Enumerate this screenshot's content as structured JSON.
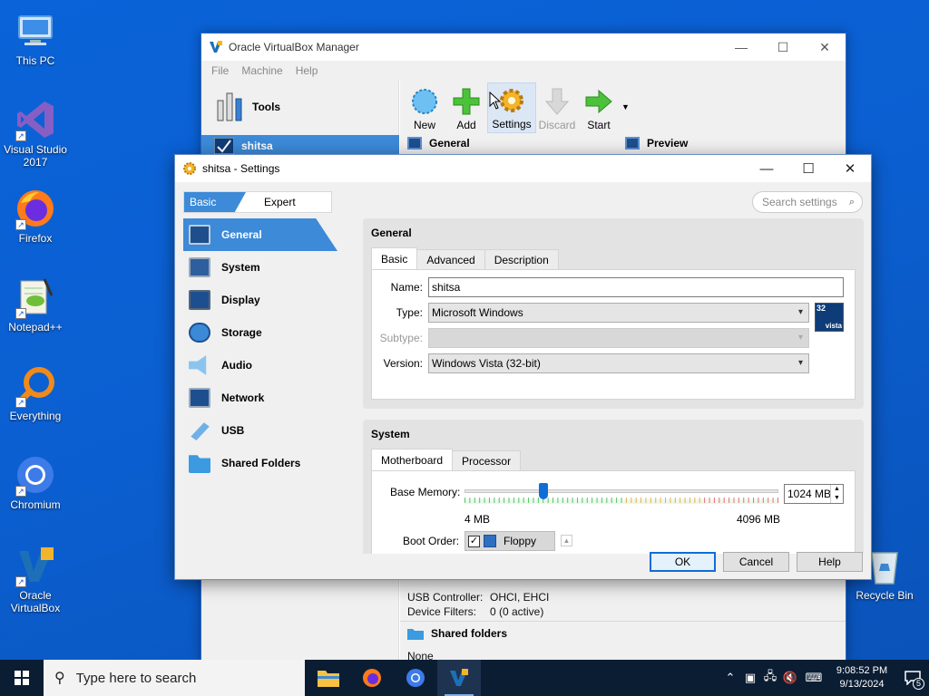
{
  "desktop": {
    "icons": [
      {
        "label": "This PC",
        "icon": "computer-icon"
      },
      {
        "label": "Visual Studio 2017",
        "icon": "visual-studio-icon"
      },
      {
        "label": "Firefox",
        "icon": "firefox-icon"
      },
      {
        "label": "Notepad++",
        "icon": "notepadpp-icon"
      },
      {
        "label": "Everything",
        "icon": "everything-icon"
      },
      {
        "label": "Chromium",
        "icon": "chromium-icon"
      },
      {
        "label": "Oracle VirtualBox",
        "icon": "virtualbox-icon"
      },
      {
        "label": "Recycle Bin",
        "icon": "recycle-bin-icon"
      }
    ]
  },
  "manager": {
    "title": "Oracle VirtualBox Manager",
    "menu": [
      "File",
      "Machine",
      "Help"
    ],
    "tools_label": "Tools",
    "vm_name": "shitsa",
    "toolbar": {
      "new": "New",
      "add": "Add",
      "settings": "Settings",
      "discard": "Discard",
      "start": "Start"
    },
    "general_header": "General",
    "preview_header": "Preview",
    "usb": {
      "controller_label": "USB Controller:",
      "controller_value": "OHCI, EHCI",
      "filters_label": "Device Filters:",
      "filters_value": "0 (0 active)"
    },
    "shared_header": "Shared folders",
    "shared_value": "None"
  },
  "dialog": {
    "title": "shitsa - Settings",
    "mode_basic": "Basic",
    "mode_expert": "Expert",
    "search_placeholder": "Search settings",
    "nav": [
      {
        "label": "General",
        "icon": "general-icon",
        "active": true
      },
      {
        "label": "System",
        "icon": "system-icon"
      },
      {
        "label": "Display",
        "icon": "display-icon"
      },
      {
        "label": "Storage",
        "icon": "storage-icon"
      },
      {
        "label": "Audio",
        "icon": "audio-icon"
      },
      {
        "label": "Network",
        "icon": "network-icon"
      },
      {
        "label": "USB",
        "icon": "usb-icon"
      },
      {
        "label": "Shared Folders",
        "icon": "shared-folders-icon"
      }
    ],
    "general": {
      "title": "General",
      "tabs": [
        "Basic",
        "Advanced",
        "Description"
      ],
      "name_label": "Name:",
      "name_value": "shitsa",
      "type_label": "Type:",
      "type_value": "Microsoft Windows",
      "subtype_label": "Subtype:",
      "subtype_value": "",
      "version_label": "Version:",
      "version_value": "Windows Vista (32-bit)",
      "os_badge_bits": "32",
      "os_badge_text": "vista"
    },
    "system": {
      "title": "System",
      "tabs": [
        "Motherboard",
        "Processor"
      ],
      "memory_label": "Base Memory:",
      "memory_value": "1024 MB",
      "memory_min": "4 MB",
      "memory_max": "4096 MB",
      "memory_fraction": 0.25,
      "boot_label": "Boot Order:",
      "boot_item": "Floppy"
    },
    "buttons": {
      "ok": "OK",
      "cancel": "Cancel",
      "help": "Help"
    }
  },
  "taskbar": {
    "search_placeholder": "Type here to search",
    "time": "9:08:52 PM",
    "date": "9/13/2024",
    "notifications": "5"
  },
  "colors": {
    "accent": "#3c8ad8",
    "desktop": "#0b5fd1",
    "taskbar": "#0b1d33"
  }
}
